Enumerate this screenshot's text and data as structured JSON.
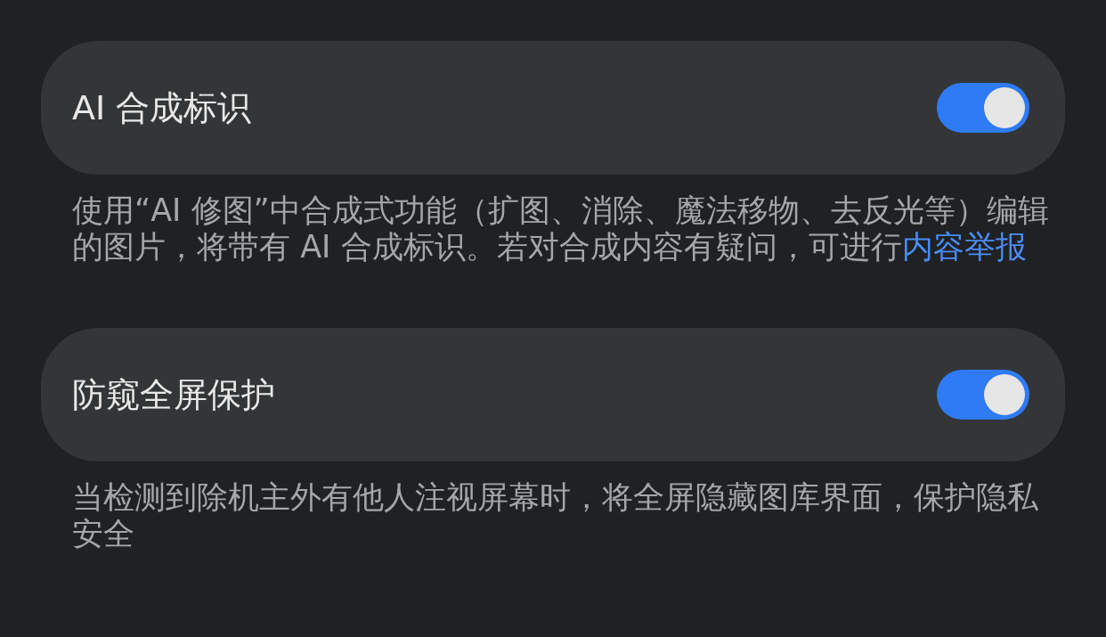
{
  "settings": [
    {
      "title": "AI 合成标识",
      "on": true,
      "description": {
        "text": "使用“AI 修图”中合成式功能（扩图、消除、魔法移物、去反光等）编辑的图片，将带有 AI 合成标识。若对合成内容有疑问，可进行",
        "link": "内容举报"
      }
    },
    {
      "title": "防窥全屏保护",
      "on": true,
      "description": {
        "text": "当检测到除机主外有他人注视屏幕时，将全屏隐藏图库界面，保护隐私安全"
      }
    }
  ]
}
